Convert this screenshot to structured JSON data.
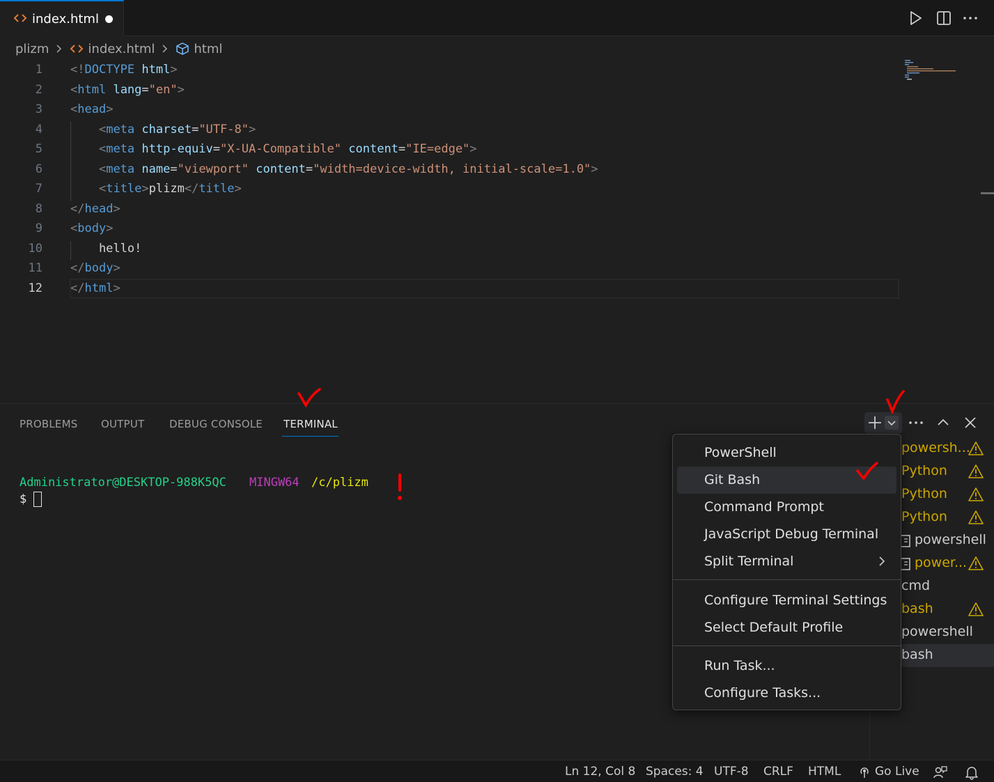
{
  "tab": {
    "label": "index.html",
    "dirty": true
  },
  "breadcrumb": {
    "folder": "plizm",
    "file": "index.html",
    "symbol": "html"
  },
  "editor": {
    "line_numbers": [
      "1",
      "2",
      "3",
      "4",
      "5",
      "6",
      "7",
      "8",
      "9",
      "10",
      "11",
      "12"
    ],
    "active_line": 12,
    "lines": [
      [
        {
          "t": "<!",
          "c": "punct"
        },
        {
          "t": "DOCTYPE",
          "c": "tag"
        },
        {
          "t": " ",
          "c": "text"
        },
        {
          "t": "html",
          "c": "attr"
        },
        {
          "t": ">",
          "c": "punct"
        }
      ],
      [
        {
          "t": "<",
          "c": "punct"
        },
        {
          "t": "html",
          "c": "tag"
        },
        {
          "t": " ",
          "c": "text"
        },
        {
          "t": "lang",
          "c": "attr"
        },
        {
          "t": "=",
          "c": "text"
        },
        {
          "t": "\"en\"",
          "c": "str"
        },
        {
          "t": ">",
          "c": "punct"
        }
      ],
      [
        {
          "t": "<",
          "c": "punct"
        },
        {
          "t": "head",
          "c": "tag"
        },
        {
          "t": ">",
          "c": "punct"
        }
      ],
      [
        {
          "t": "    ",
          "c": "text"
        },
        {
          "t": "<",
          "c": "punct"
        },
        {
          "t": "meta",
          "c": "tag"
        },
        {
          "t": " ",
          "c": "text"
        },
        {
          "t": "charset",
          "c": "attr"
        },
        {
          "t": "=",
          "c": "text"
        },
        {
          "t": "\"UTF-8\"",
          "c": "str"
        },
        {
          "t": ">",
          "c": "punct"
        }
      ],
      [
        {
          "t": "    ",
          "c": "text"
        },
        {
          "t": "<",
          "c": "punct"
        },
        {
          "t": "meta",
          "c": "tag"
        },
        {
          "t": " ",
          "c": "text"
        },
        {
          "t": "http-equiv",
          "c": "attr"
        },
        {
          "t": "=",
          "c": "text"
        },
        {
          "t": "\"X-UA-Compatible\"",
          "c": "str"
        },
        {
          "t": " ",
          "c": "text"
        },
        {
          "t": "content",
          "c": "attr"
        },
        {
          "t": "=",
          "c": "text"
        },
        {
          "t": "\"IE=edge\"",
          "c": "str"
        },
        {
          "t": ">",
          "c": "punct"
        }
      ],
      [
        {
          "t": "    ",
          "c": "text"
        },
        {
          "t": "<",
          "c": "punct"
        },
        {
          "t": "meta",
          "c": "tag"
        },
        {
          "t": " ",
          "c": "text"
        },
        {
          "t": "name",
          "c": "attr"
        },
        {
          "t": "=",
          "c": "text"
        },
        {
          "t": "\"viewport\"",
          "c": "str"
        },
        {
          "t": " ",
          "c": "text"
        },
        {
          "t": "content",
          "c": "attr"
        },
        {
          "t": "=",
          "c": "text"
        },
        {
          "t": "\"width=device-width, initial-scale=1.0\"",
          "c": "str"
        },
        {
          "t": ">",
          "c": "punct"
        }
      ],
      [
        {
          "t": "    ",
          "c": "text"
        },
        {
          "t": "<",
          "c": "punct"
        },
        {
          "t": "title",
          "c": "tag"
        },
        {
          "t": ">",
          "c": "punct"
        },
        {
          "t": "plizm",
          "c": "text"
        },
        {
          "t": "</",
          "c": "punct"
        },
        {
          "t": "title",
          "c": "tag"
        },
        {
          "t": ">",
          "c": "punct"
        }
      ],
      [
        {
          "t": "</",
          "c": "punct"
        },
        {
          "t": "head",
          "c": "tag"
        },
        {
          "t": ">",
          "c": "punct"
        }
      ],
      [
        {
          "t": "<",
          "c": "punct"
        },
        {
          "t": "body",
          "c": "tag"
        },
        {
          "t": ">",
          "c": "punct"
        }
      ],
      [
        {
          "t": "    hello!",
          "c": "text"
        }
      ],
      [
        {
          "t": "</",
          "c": "punct"
        },
        {
          "t": "body",
          "c": "tag"
        },
        {
          "t": ">",
          "c": "punct"
        }
      ],
      [
        {
          "t": "</",
          "c": "punct"
        },
        {
          "t": "html",
          "c": "tag"
        },
        {
          "t": ">",
          "c": "punct"
        }
      ]
    ]
  },
  "panel": {
    "tabs": [
      "PROBLEMS",
      "OUTPUT",
      "DEBUG CONSOLE",
      "TERMINAL"
    ],
    "active_tab": "TERMINAL"
  },
  "terminal": {
    "user_host": "Administrator@DESKTOP-988K5QC",
    "env": "MINGW64",
    "path": "/c/plizm",
    "prompt": "$"
  },
  "terminal_list": [
    {
      "name": "powersh...",
      "warn": true,
      "square": false,
      "color": "#cca700"
    },
    {
      "name": "Python",
      "warn": true,
      "square": false,
      "color": "#cca700"
    },
    {
      "name": "Python",
      "warn": true,
      "square": false,
      "color": "#cca700"
    },
    {
      "name": "Python",
      "warn": true,
      "square": false,
      "color": "#cca700"
    },
    {
      "name": "powershell",
      "warn": false,
      "square": true,
      "color": "#cccccc"
    },
    {
      "name": "power...",
      "warn": true,
      "square": true,
      "color": "#cca700"
    },
    {
      "name": "cmd",
      "warn": false,
      "square": false,
      "color": "#cccccc"
    },
    {
      "name": "bash",
      "warn": true,
      "square": false,
      "color": "#cca700"
    },
    {
      "name": "powershell",
      "warn": false,
      "square": false,
      "color": "#cccccc"
    },
    {
      "name": "bash",
      "warn": false,
      "square": false,
      "color": "#cccccc",
      "selected": true
    }
  ],
  "menu": {
    "group1": [
      "PowerShell",
      "Git Bash",
      "Command Prompt",
      "JavaScript Debug Terminal",
      "Split Terminal"
    ],
    "group2": [
      "Configure Terminal Settings",
      "Select Default Profile"
    ],
    "group3": [
      "Run Task...",
      "Configure Tasks..."
    ],
    "hovered": "Git Bash"
  },
  "status": {
    "position": "Ln 12, Col 8",
    "spaces": "Spaces: 4",
    "encoding": "UTF-8",
    "eol": "CRLF",
    "language": "HTML",
    "go_live": "Go Live"
  },
  "colors": {
    "accent": "#0078d4",
    "warning": "#cca700",
    "terminal_green": "#23d18b",
    "terminal_magenta": "#bc3fbc",
    "terminal_yellow": "#e5e510",
    "annotation_red": "#ff0000"
  }
}
